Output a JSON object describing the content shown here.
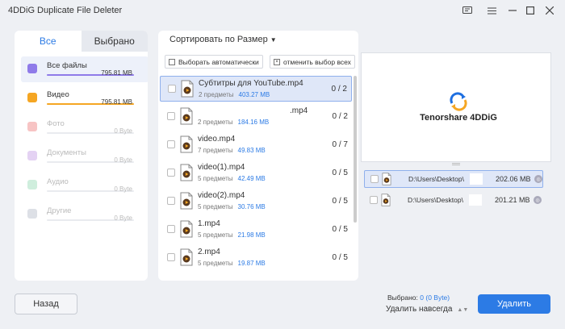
{
  "window": {
    "title": "4DDiG Duplicate File Deleter"
  },
  "tabs": [
    {
      "label": "Все",
      "active": true
    },
    {
      "label": "Выбрано",
      "active": false
    }
  ],
  "categories": [
    {
      "name": "Все файлы",
      "size": "795.81 MB",
      "color": "#8f7be9",
      "fill": 1.0,
      "selected": true,
      "enabled": true,
      "icon": "folder-icon"
    },
    {
      "name": "Видео",
      "size": "795.81 MB",
      "color": "#f5a623",
      "fill": 1.0,
      "selected": false,
      "enabled": true,
      "icon": "video-icon"
    },
    {
      "name": "Фото",
      "size": "0 Byte",
      "color": "#f7c4c4",
      "fill": 0,
      "selected": false,
      "enabled": false,
      "icon": "photo-icon"
    },
    {
      "name": "Документы",
      "size": "0 Byte",
      "color": "#e4d2f3",
      "fill": 0,
      "selected": false,
      "enabled": false,
      "icon": "document-icon"
    },
    {
      "name": "Аудио",
      "size": "0 Byte",
      "color": "#cfeedd",
      "fill": 0,
      "selected": false,
      "enabled": false,
      "icon": "audio-icon"
    },
    {
      "name": "Другие",
      "size": "0 Byte",
      "color": "#dde0e6",
      "fill": 0,
      "selected": false,
      "enabled": false,
      "icon": "other-icon"
    }
  ],
  "middle": {
    "sort_label": "Сортировать по Размер",
    "auto_select_label": "Выборать автоматически",
    "deselect_all_label": "отменить выбор всех",
    "files": [
      {
        "name": "Субтитры для YouTube.mp4",
        "items": "2 предметы",
        "size": "403.27 MB",
        "count": "0 / 2",
        "selected": true
      },
      {
        "name": ".mp4",
        "items": "2 предметы",
        "size": "184.16 MB",
        "count": "0 / 2",
        "selected": false
      },
      {
        "name": "video.mp4",
        "items": "7 предметы",
        "size": "49.83 MB",
        "count": "0 / 7",
        "selected": false
      },
      {
        "name": "video(1).mp4",
        "items": "5 предметы",
        "size": "42.49 MB",
        "count": "0 / 5",
        "selected": false
      },
      {
        "name": "video(2).mp4",
        "items": "5 предметы",
        "size": "30.76 MB",
        "count": "0 / 5",
        "selected": false
      },
      {
        "name": "1.mp4",
        "items": "5 предметы",
        "size": "21.98 MB",
        "count": "0 / 5",
        "selected": false
      },
      {
        "name": "2.mp4",
        "items": "5 предметы",
        "size": "19.87 MB",
        "count": "0 / 5",
        "selected": false
      }
    ]
  },
  "preview": {
    "logo_text": "Tenorshare 4DDiG"
  },
  "duplicates": [
    {
      "path": "D:\\Users\\Desktop\\",
      "size": "202.06 MB",
      "selected": true
    },
    {
      "path": "D:\\Users\\Desktop\\",
      "size": "201.21 MB",
      "selected": false
    }
  ],
  "footer": {
    "back_label": "Назад",
    "selected_prefix": "Выбрано: ",
    "selected_count": "0",
    "selected_size": "(0 Byte)",
    "delete_mode": "Удалить навсегда",
    "delete_label": "Удалить"
  },
  "colors": {
    "accent": "#2c7be5",
    "selection": "#dfe7f8"
  }
}
